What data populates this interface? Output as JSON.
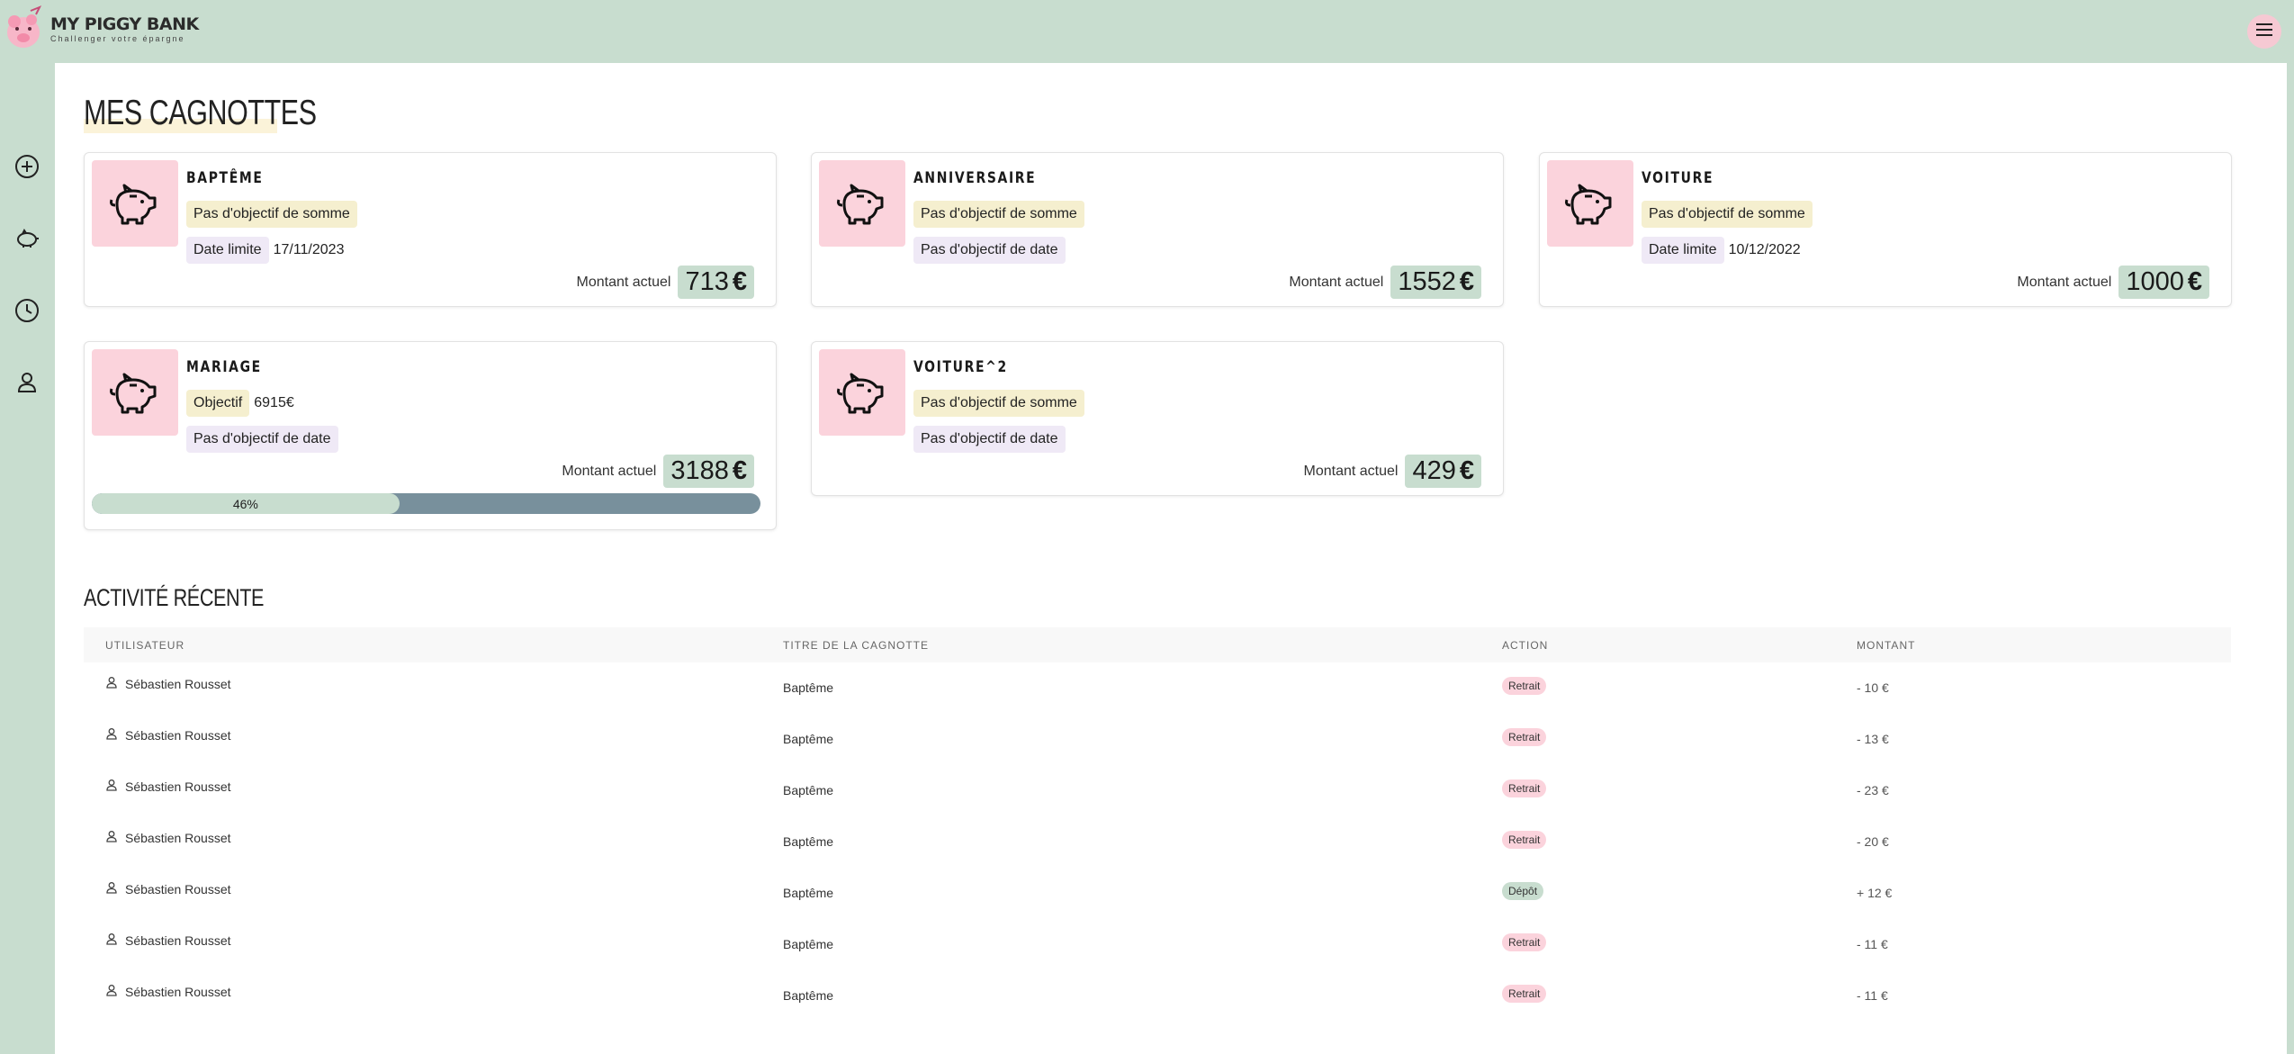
{
  "brand": {
    "title": "MY PIGGY BANK",
    "subtitle": "Challenger votre épargne"
  },
  "sidebar": {
    "items": [
      {
        "icon": "plus-circle-icon"
      },
      {
        "icon": "piggy-bank-icon"
      },
      {
        "icon": "clock-icon"
      },
      {
        "icon": "user-icon"
      }
    ]
  },
  "main": {
    "title": "MES CAGNOTTES",
    "amount_label": "Montant actuel",
    "currency": "€",
    "cards": [
      {
        "title": "BAPTÊME",
        "goal_chip": "Pas d'objectif de somme",
        "goal_value": "",
        "date_chip": "Date limite",
        "date_value": "17/11/2023",
        "amount": "713"
      },
      {
        "title": "ANNIVERSAIRE",
        "goal_chip": "Pas d'objectif de somme",
        "goal_value": "",
        "date_chip": "Pas d'objectif de date",
        "date_value": "",
        "amount": "1552"
      },
      {
        "title": "VOITURE",
        "goal_chip": "Pas d'objectif de somme",
        "goal_value": "",
        "date_chip": "Date limite",
        "date_value": "10/12/2022",
        "amount": "1000"
      },
      {
        "title": "MARIAGE",
        "goal_chip": "Objectif",
        "goal_value": "6915€",
        "date_chip": "Pas d'objectif de date",
        "date_value": "",
        "amount": "3188",
        "progress_label": "46%",
        "progress": 0.46
      },
      {
        "title": "VOITURE^2",
        "goal_chip": "Pas d'objectif de somme",
        "goal_value": "",
        "date_chip": "Pas d'objectif de date",
        "date_value": "",
        "amount": "429"
      }
    ]
  },
  "activity": {
    "title": "ACTIVITÉ RÉCENTE",
    "headers": [
      "UTILISATEUR",
      "TITRE DE LA CAGNOTTE",
      "ACTION",
      "MONTANT"
    ],
    "rows": [
      {
        "user": "Sébastien Rousset",
        "title": "Baptême",
        "action": "Retrait",
        "amount": "- 10 €"
      },
      {
        "user": "Sébastien Rousset",
        "title": "Baptême",
        "action": "Retrait",
        "amount": "- 13 €"
      },
      {
        "user": "Sébastien Rousset",
        "title": "Baptême",
        "action": "Retrait",
        "amount": "- 23 €"
      },
      {
        "user": "Sébastien Rousset",
        "title": "Baptême",
        "action": "Retrait",
        "amount": "- 20 €"
      },
      {
        "user": "Sébastien Rousset",
        "title": "Baptême",
        "action": "Dépôt",
        "amount": "+ 12 €"
      },
      {
        "user": "Sébastien Rousset",
        "title": "Baptême",
        "action": "Retrait",
        "amount": "- 11 €"
      },
      {
        "user": "Sébastien Rousset",
        "title": "Baptême",
        "action": "Retrait",
        "amount": "- 11 €"
      }
    ]
  },
  "colors": {
    "accent_green": "#c8ddcf",
    "accent_pink": "#fbd3dc",
    "chip_yellow": "#f5efcf",
    "chip_purple": "#efe9f6",
    "progress_track": "#78909c"
  }
}
